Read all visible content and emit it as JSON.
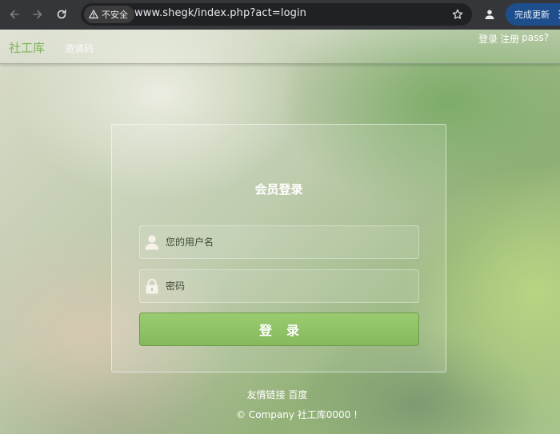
{
  "browser": {
    "url": "www.shegk/index.php?act=login",
    "security_label": "不安全",
    "update_button": "完成更新",
    "icons": {
      "back": "arrow-left-icon",
      "forward": "arrow-right-icon",
      "reload": "reload-icon",
      "warning": "warning-triangle-icon",
      "bookmark": "star-icon",
      "profile": "person-icon",
      "menu": "kebab-menu-icon"
    }
  },
  "site_nav": {
    "brand": "社工库",
    "invite": "邀请码",
    "right_links": [
      "登录",
      "注册",
      "pass?"
    ]
  },
  "login": {
    "title": "会员登录",
    "username_placeholder": "您的用户名",
    "password_placeholder": "密码",
    "submit_label": "登录",
    "icons": {
      "username": "user-icon",
      "password": "lock-icon"
    }
  },
  "footer": {
    "links": [
      "友情链接",
      "百度"
    ],
    "copyright": "© Company 社工库0000 !"
  },
  "colors": {
    "brand": "#7fb55a",
    "login_button": "#8ec164",
    "chrome_bg": "#35363a",
    "update_button_bg": "#1e4e8c"
  }
}
